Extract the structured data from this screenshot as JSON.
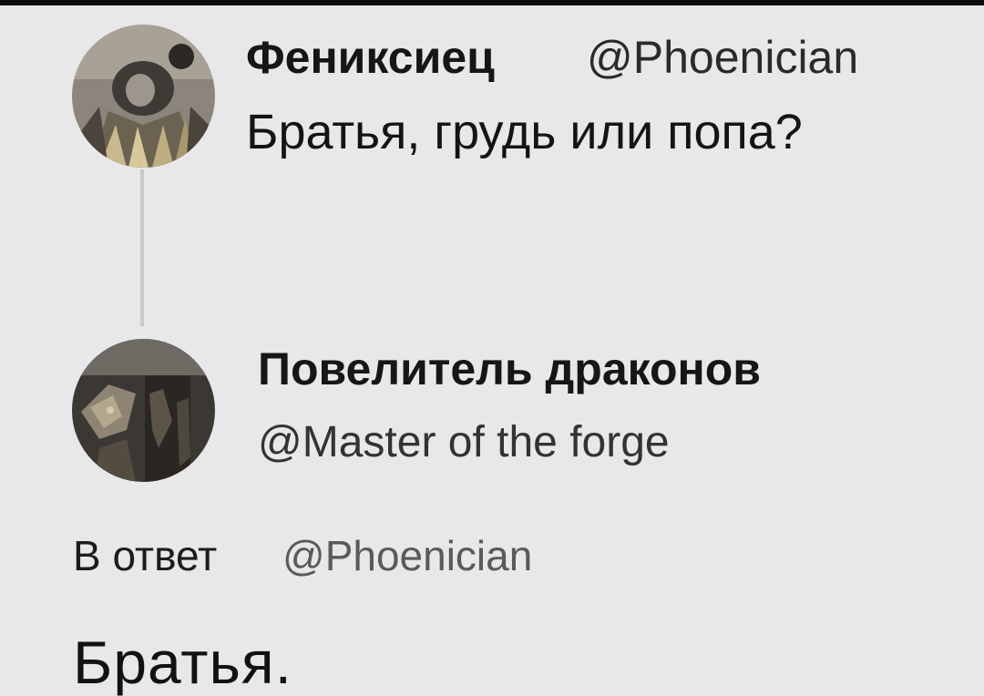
{
  "original_tweet": {
    "display_name": "Фениксиец",
    "handle": "@Phoenician",
    "text": "Братья, грудь или попа?",
    "avatar_icon": "armored-figure-avatar"
  },
  "reply_tweet": {
    "display_name": "Повелитель драконов",
    "handle": "@Master of the forge",
    "reply_prefix": "В ответ",
    "reply_to_handle": "@Phoenician",
    "text": "Братья.",
    "avatar_icon": "dragon-avatar"
  },
  "colors": {
    "background": "#e8e8ea",
    "thread_line": "#c9c9cb",
    "reply_to_handle": "#5a5a5c"
  }
}
